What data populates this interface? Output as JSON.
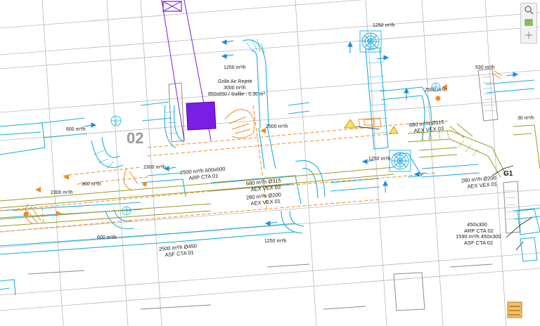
{
  "colors": {
    "background": "#ffffff",
    "grid": "#b8b8b8",
    "duct_blue": "#19aee0",
    "duct_orange": "#f08a1c",
    "duct_olive": "#9a9a22",
    "grille_purple": "#7a1ee6",
    "arrow_blue": "#1a8fd0",
    "dark": "#1a1a1a"
  },
  "labels": {
    "grille_title": "Grille Air Rejeté",
    "grille_flow": "3000 m³/h",
    "grille_size": "850x850 / Suillie : 0.36 m²",
    "flow_1250_top": "1250 m³/h",
    "flow_1250_left": "1250 m³/h",
    "flow_530": "530 m³/h",
    "flow_2500_right": "2500 m³/h",
    "flow_2500_mid": "2500 m³/h",
    "flow_30": "30 m³/h",
    "flow_600_a": "600 m³/h",
    "flow_2300_a": "2300 m³/h",
    "flow_900": "900 m³/h",
    "flow_2300_b": "2300 m³/h",
    "flow_1250_mid": "1250 m³/h",
    "flow_600_b": "600 m³/h",
    "flow_1250_low": "1250 m³/h",
    "number_02": "02",
    "arp01_spec": "2500 m³/h 600x600",
    "arp01_name": "ARP CTA 01",
    "vex03_spec_a": "680 m³/h Ø315",
    "vex03_name_a": "AEX VEX 03",
    "vex03_spec_b": "680 m³/h Ø315",
    "vex03_name_b": "AEX VEX 03",
    "vex01_spec_a": "280 m³/h Ø200",
    "vex01_name_a": "AEX VEX 01",
    "vex01_spec_b": "280 m³/h Ø200",
    "vex01_name_b": "AEX VEX 01",
    "asf01_spec": "2500 m³/h Ø450",
    "asf01_name": "ASF CTA 01",
    "arp02_spec": "450x300",
    "arp02_name": "ARP CTA 02",
    "asf02_spec": "1590 m³/h 450x300",
    "asf02_name": "ASF CTA 02",
    "g1": "G1"
  },
  "toolbar": {
    "zoom_icon": "magnifier-icon",
    "layers_icon": "layers-icon",
    "pan_icon": "hand-icon"
  }
}
